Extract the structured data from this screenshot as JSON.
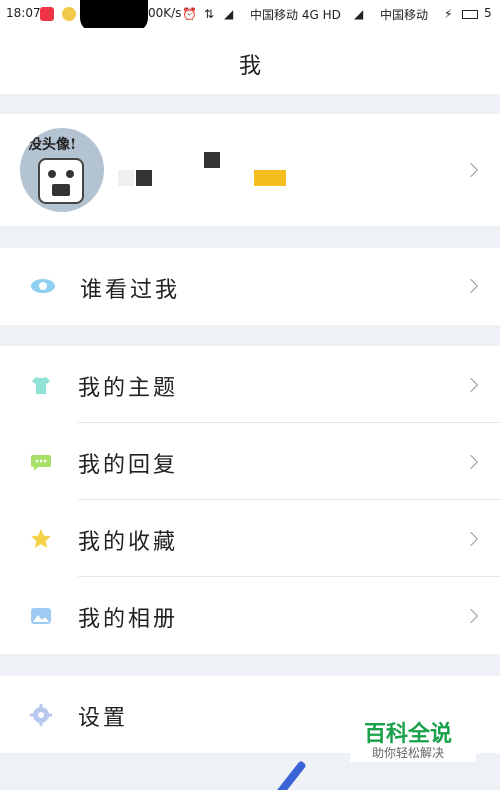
{
  "status": {
    "time": "18:07",
    "speed": "00K/s",
    "carrier1": "中国移动 4G HD",
    "carrier2": "中国移动",
    "battery": "5"
  },
  "header": {
    "title": "我"
  },
  "profile": {
    "avatar_caption": "没头像!"
  },
  "section1": {
    "label": "谁看过我"
  },
  "menu": [
    {
      "label": "我的主题",
      "icon": "shirt-icon"
    },
    {
      "label": "我的回复",
      "icon": "chat-icon"
    },
    {
      "label": "我的收藏",
      "icon": "star-icon"
    },
    {
      "label": "我的相册",
      "icon": "photo-icon"
    }
  ],
  "settings": {
    "label": "设置",
    "icon": "gear-icon"
  },
  "watermark": {
    "title": "百科全说",
    "subtitle": "助你轻松解决"
  },
  "colors": {
    "accent_eye": "#8fd0f0",
    "shirt": "#8ee3d6",
    "chat": "#a8e06a",
    "star": "#f6d24a",
    "photo": "#9ecbf2",
    "gear": "#b8c8ee"
  }
}
